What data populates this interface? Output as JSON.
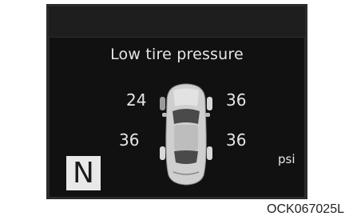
{
  "display": {
    "title": "Low tire pressure",
    "tires": {
      "front_left": "24",
      "front_right": "36",
      "rear_left": "36",
      "rear_right": "36"
    },
    "unit": "psi",
    "gear": "N",
    "low_tire": "front-left",
    "colors": {
      "screen": "#111111",
      "text": "#e6e6e6",
      "car_body": "#cfcfcf"
    },
    "icons": [
      "car-icon",
      "tire-icon"
    ]
  },
  "figure_code": "OCK067025L"
}
